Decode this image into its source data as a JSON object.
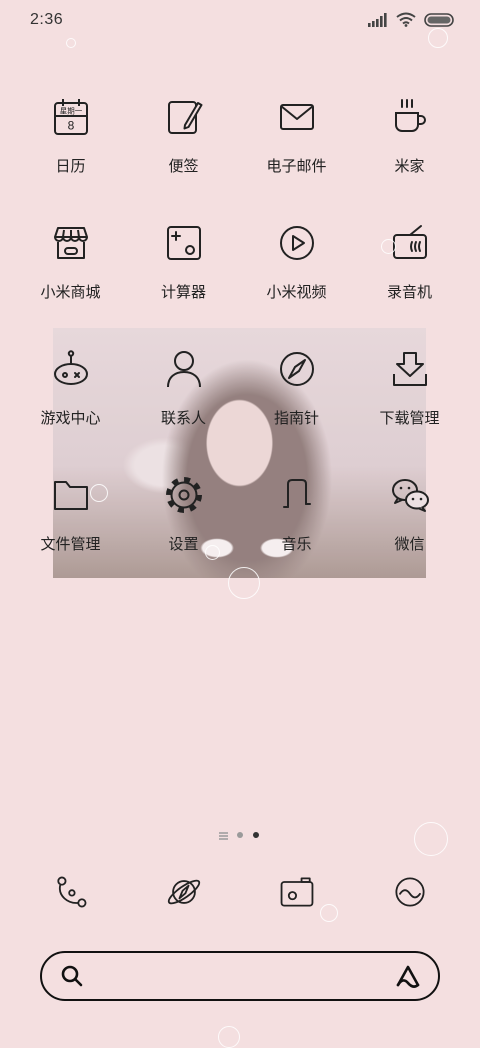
{
  "status_bar": {
    "time": "2:36",
    "icons": [
      "signal-icon",
      "wifi-icon",
      "battery-icon"
    ]
  },
  "calendar_icon": {
    "weekday": "星期一",
    "day": "8"
  },
  "apps": [
    {
      "label": "日历",
      "icon": "calendar-icon"
    },
    {
      "label": "便签",
      "icon": "notes-icon"
    },
    {
      "label": "电子邮件",
      "icon": "mail-icon"
    },
    {
      "label": "米家",
      "icon": "cup-icon"
    },
    {
      "label": "小米商城",
      "icon": "store-icon"
    },
    {
      "label": "计算器",
      "icon": "calculator-icon"
    },
    {
      "label": "小米视频",
      "icon": "play-icon"
    },
    {
      "label": "录音机",
      "icon": "radio-icon"
    },
    {
      "label": "游戏中心",
      "icon": "robot-icon"
    },
    {
      "label": "联系人",
      "icon": "person-icon"
    },
    {
      "label": "指南针",
      "icon": "compass-icon"
    },
    {
      "label": "下载管理",
      "icon": "download-icon"
    },
    {
      "label": "文件管理",
      "icon": "folder-icon"
    },
    {
      "label": "设置",
      "icon": "gear-icon"
    },
    {
      "label": "音乐",
      "icon": "music-icon"
    },
    {
      "label": "微信",
      "icon": "chat-bubbles-icon"
    }
  ],
  "page_indicator": {
    "items": [
      "list",
      "dot",
      "dot"
    ],
    "active_index": 2
  },
  "dock": [
    {
      "icon": "phone-icon"
    },
    {
      "icon": "browser-icon"
    },
    {
      "icon": "camera-icon"
    },
    {
      "icon": "messages-icon"
    }
  ],
  "search_bar": {
    "left_icon": "search-icon",
    "right_icon": "assistant-icon"
  },
  "colors": {
    "background": "#f4dfe0",
    "icon_stroke": "#222222",
    "dot_inactive": "#9a9a9a",
    "dot_active": "#333333"
  }
}
